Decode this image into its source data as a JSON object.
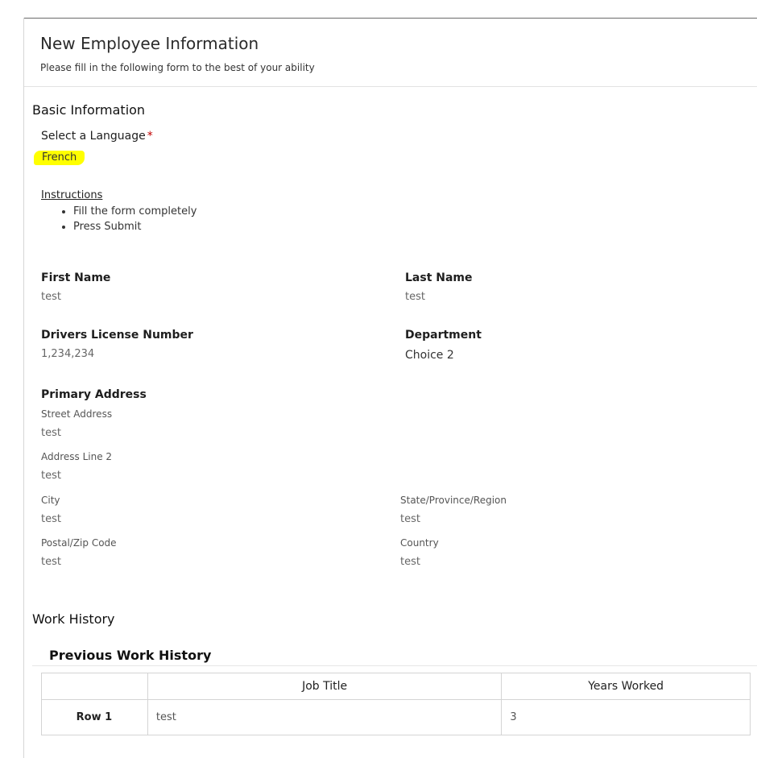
{
  "form": {
    "title": "New Employee Information",
    "description": "Please fill in the following form to the best of your ability"
  },
  "basic_info": {
    "heading": "Basic Information",
    "language": {
      "label": "Select a Language",
      "required_mark": "*",
      "value": "French"
    },
    "instructions": {
      "title": "Instructions",
      "items": [
        "Fill the form completely",
        "Press Submit"
      ]
    },
    "first_name": {
      "label": "First Name",
      "value": "test"
    },
    "last_name": {
      "label": "Last Name",
      "value": "test"
    },
    "drivers_license": {
      "label": "Drivers License Number",
      "value": "1,234,234"
    },
    "department": {
      "label": "Department",
      "value": "Choice 2"
    },
    "primary_address": {
      "label": "Primary Address",
      "street": {
        "label": "Street Address",
        "value": "test"
      },
      "line2": {
        "label": "Address Line 2",
        "value": "test"
      },
      "city": {
        "label": "City",
        "value": "test"
      },
      "state": {
        "label": "State/Province/Region",
        "value": "test"
      },
      "postal": {
        "label": "Postal/Zip Code",
        "value": "test"
      },
      "country": {
        "label": "Country",
        "value": "test"
      }
    }
  },
  "work_history": {
    "heading": "Work History",
    "subheading": "Previous Work History",
    "columns": [
      "",
      "Job Title",
      "Years Worked"
    ],
    "rows": [
      {
        "label": "Row 1",
        "job_title": "test",
        "years_worked": "3"
      }
    ]
  },
  "colors": {
    "highlight": "#ffff00",
    "required": "#c00000"
  }
}
